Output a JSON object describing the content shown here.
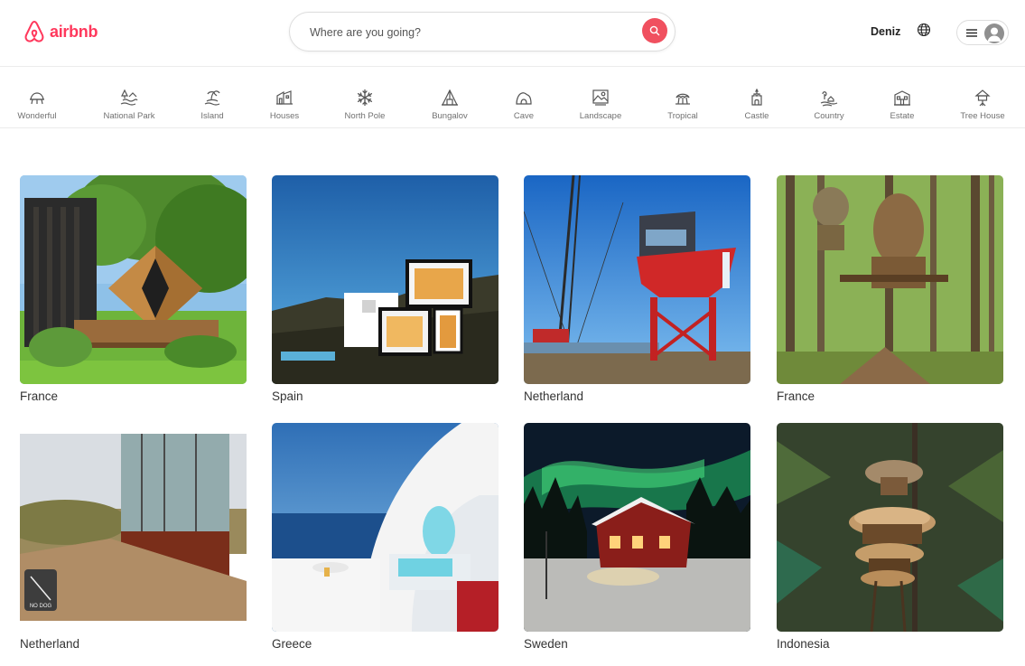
{
  "header": {
    "brand": "airbnb",
    "search_placeholder": "Where are you going?",
    "user_name": "Deniz"
  },
  "categories": [
    {
      "label": "Wonderful",
      "icon": "wonderful-icon"
    },
    {
      "label": "National Park",
      "icon": "national-park-icon"
    },
    {
      "label": "Island",
      "icon": "island-icon"
    },
    {
      "label": "Houses",
      "icon": "houses-icon"
    },
    {
      "label": "North Pole",
      "icon": "snowflake-icon"
    },
    {
      "label": "Bungalov",
      "icon": "bungalov-icon"
    },
    {
      "label": "Cave",
      "icon": "cave-icon"
    },
    {
      "label": "Landscape",
      "icon": "landscape-icon"
    },
    {
      "label": "Tropical",
      "icon": "tropical-icon"
    },
    {
      "label": "Castle",
      "icon": "castle-icon"
    },
    {
      "label": "Country",
      "icon": "country-icon"
    },
    {
      "label": "Estate",
      "icon": "estate-icon"
    },
    {
      "label": "Tree House",
      "icon": "tree-house-icon"
    }
  ],
  "listings": [
    {
      "title": "France",
      "image": "wooden-cabin-garden-photo"
    },
    {
      "title": "Spain",
      "image": "modern-cliff-house-photo"
    },
    {
      "title": "Netherland",
      "image": "red-crane-house-photo"
    },
    {
      "title": "France",
      "image": "forest-treehouse-photo"
    },
    {
      "title": "Netherland",
      "image": "mirror-house-dunes-photo"
    },
    {
      "title": "Greece",
      "image": "santorini-pool-photo"
    },
    {
      "title": "Sweden",
      "image": "aurora-red-cabin-photo"
    },
    {
      "title": "Indonesia",
      "image": "jungle-bamboo-treehouse-photo"
    }
  ],
  "colors": {
    "brand": "#ff385c",
    "search_button": "#f0505f",
    "muted_text": "#717171"
  }
}
